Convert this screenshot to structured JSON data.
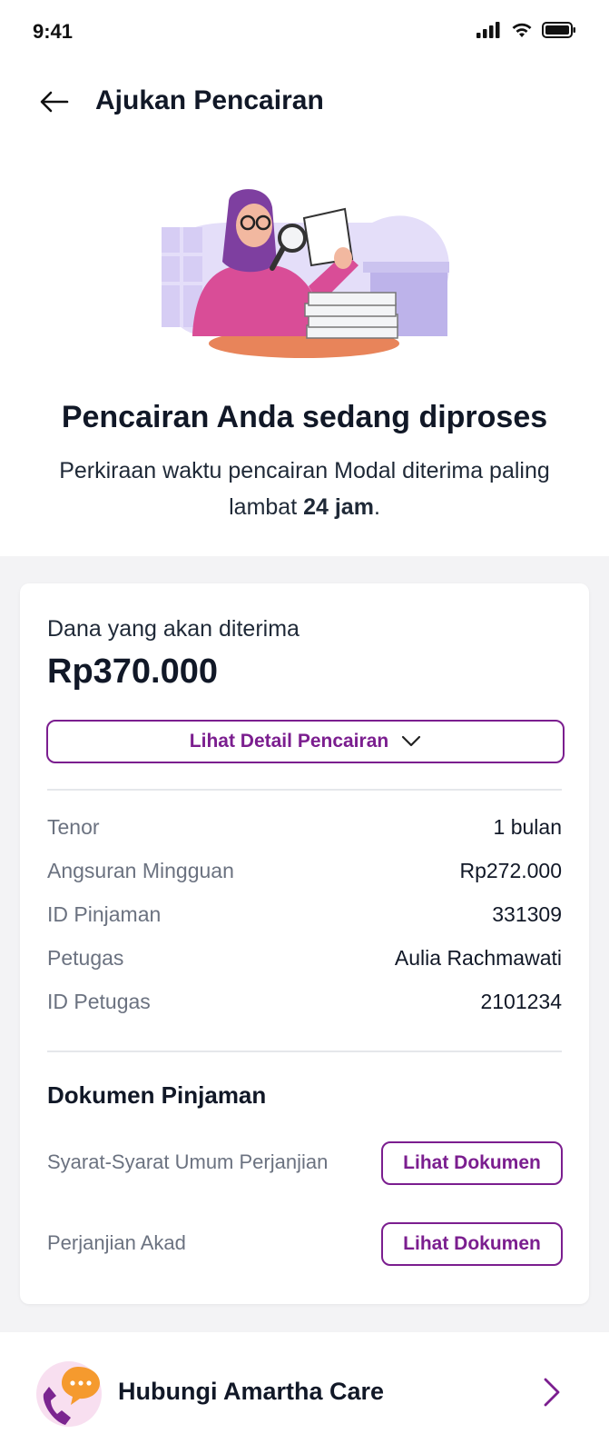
{
  "status_bar": {
    "time": "9:41"
  },
  "header": {
    "title": "Ajukan Pencairan"
  },
  "hero": {
    "headline": "Pencairan Anda sedang diproses",
    "sub_prefix": "Perkiraan waktu pencairan Modal diterima paling lambat ",
    "sub_bold": "24 jam",
    "sub_suffix": "."
  },
  "card": {
    "amount_label": "Dana yang akan diterima",
    "amount": "Rp370.000",
    "detail_button": "Lihat Detail Pencairan",
    "rows": [
      {
        "label": "Tenor",
        "value": "1 bulan"
      },
      {
        "label": "Angsuran Mingguan",
        "value": "Rp272.000"
      },
      {
        "label": "ID Pinjaman",
        "value": "331309"
      },
      {
        "label": "Petugas",
        "value": "Aulia Rachmawati"
      },
      {
        "label": "ID Petugas",
        "value": "2101234"
      }
    ],
    "documents_title": "Dokumen Pinjaman",
    "documents": [
      {
        "label": "Syarat-Syarat Umum Perjanjian",
        "button": "Lihat Dokumen"
      },
      {
        "label": "Perjanjian Akad",
        "button": "Lihat Dokumen"
      }
    ]
  },
  "care": {
    "label": "Hubungi Amartha Care"
  },
  "colors": {
    "accent": "#7b1e8f",
    "muted_text": "#6b7280",
    "background": "#f3f3f5"
  }
}
